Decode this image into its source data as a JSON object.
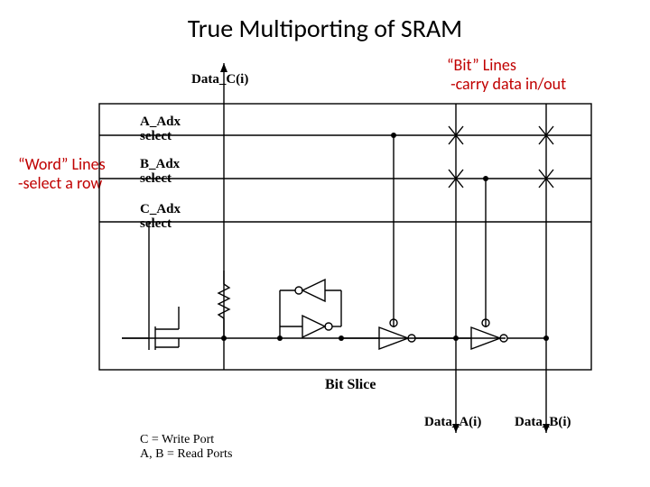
{
  "title": "True Multiporting of SRAM",
  "annotations": {
    "bit_title": "“Bit” Lines",
    "bit_sub": "-carry data in/out",
    "word_title": "“Word” Lines",
    "word_sub": "-select a row"
  },
  "labels": {
    "data_c": "Data_C(i)",
    "a_adx": "A_Adx select",
    "b_adx": "B_Adx select",
    "c_adx": "C_Adx select",
    "bit_slice": "Bit Slice",
    "data_a": "Data_A(i)",
    "data_b": "Data_B(i)",
    "legend1": "C = Write Port",
    "legend2": "A, B = Read Ports"
  }
}
